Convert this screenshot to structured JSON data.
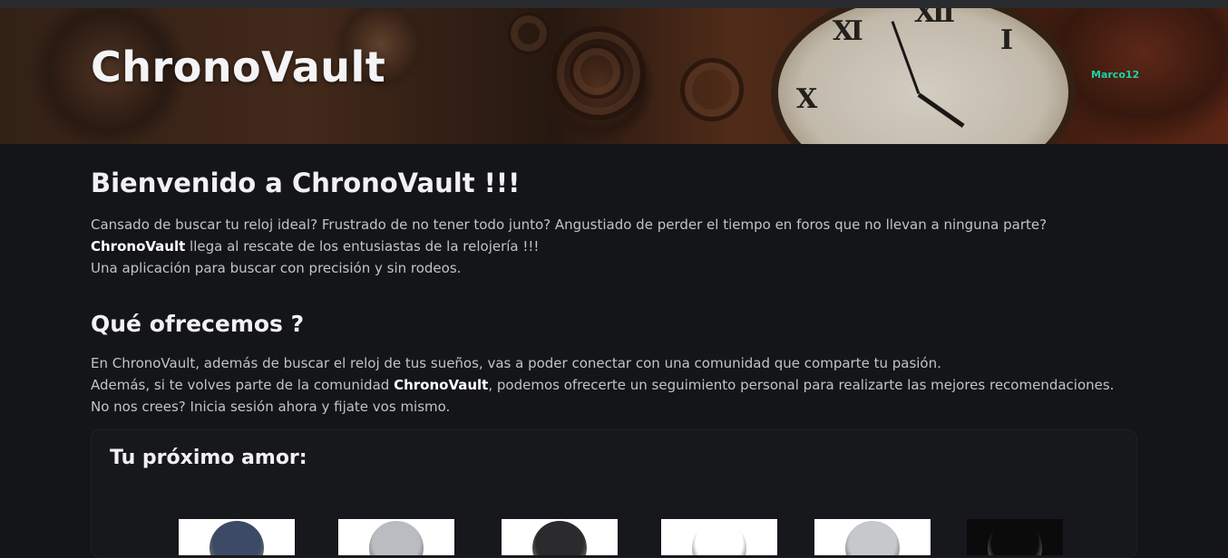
{
  "header": {
    "brand": "ChronoVault",
    "user": "Marco12"
  },
  "welcome": {
    "title": "Bienvenido a ChronoVault !!!",
    "line1": "Cansado de buscar tu reloj ideal? Frustrado de no tener todo junto? Angustiado de perder el tiempo en foros que no llevan a ninguna parte?",
    "line2_bold": "ChronoVault",
    "line2_rest": " llega al rescate de los entusiastas de la relojería !!!",
    "line3": "Una aplicación para buscar con precisión y sin rodeos."
  },
  "offer": {
    "title": "Qué ofrecemos ?",
    "line1": "En ChronoVault, además de buscar el reloj de tus sueños, vas a poder conectar con una comunidad que comparte tu pasión.",
    "line2_pre": "Además, si te volves parte de la comunidad ",
    "line2_bold": "ChronoVault",
    "line2_post": ", podemos ofrecerte un seguimiento personal para realizarte las mejores recomendaciones. No nos crees? Inicia sesión ahora y fijate vos mismo."
  },
  "recommendations": {
    "title": "Tu próximo amor:",
    "items": [
      {
        "color": "#3d4a66"
      },
      {
        "color": "#b9bcc1"
      },
      {
        "color": "#2b2b2d"
      },
      {
        "color": "#ffffff"
      },
      {
        "color": "#c6c8cc"
      },
      {
        "color": "#0b0b0c"
      }
    ]
  }
}
